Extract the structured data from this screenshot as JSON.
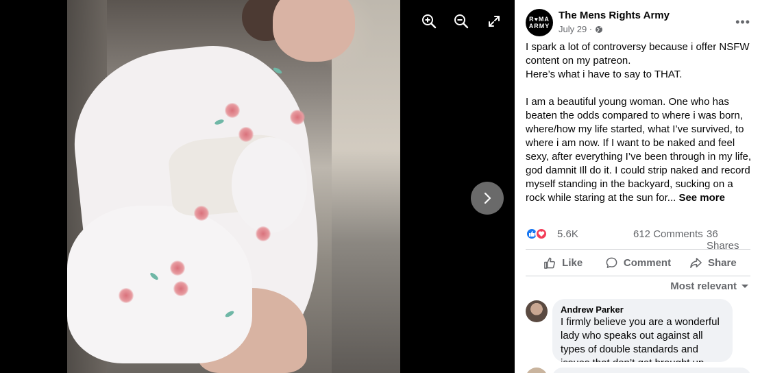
{
  "viewer": {
    "icons": {
      "zoom_in": "zoom-in-icon",
      "zoom_out": "zoom-out-icon",
      "fullscreen": "fullscreen-icon",
      "next": "chevron-right-icon"
    }
  },
  "post": {
    "page_avatar_text": "R♥MA ARMY",
    "page_name": "The Mens Rights Army",
    "date": "July 29 ·",
    "privacy_icon": "globe-icon",
    "more_options": "•••",
    "text_lines": [
      "I spark a lot of controversy because i offer NSFW content on my patreon.",
      "Here’s what i have to say to THAT."
    ],
    "text_para2": "I am a beautiful young woman. One who has beaten the odds compared to where i was born, where/how my life started, what I’ve survived, to where i am now. If I want to be naked and feel sexy, after everything I’ve been through in my life, god damnit Ill do it. I could strip naked and record myself standing in the backyard, sucking on a rock while staring at the sun for...",
    "see_more": "See more",
    "reaction_count": "5.6K",
    "comments_count": "612 Comments",
    "shares_count": "36 Shares",
    "actions": {
      "like": "Like",
      "comment": "Comment",
      "share": "Share"
    },
    "sort_label": "Most relevant"
  },
  "comments": [
    {
      "author": "Andrew Parker",
      "text": "I firmly believe you are a wonderful lady who speaks out against all types of double standards and issues that don’t get brought up"
    }
  ],
  "colors": {
    "primary_text": "#050505",
    "secondary_text": "#65676b",
    "like_blue": "#1877f2",
    "love_red": "#f33e58",
    "bubble_bg": "#f0f2f5"
  }
}
